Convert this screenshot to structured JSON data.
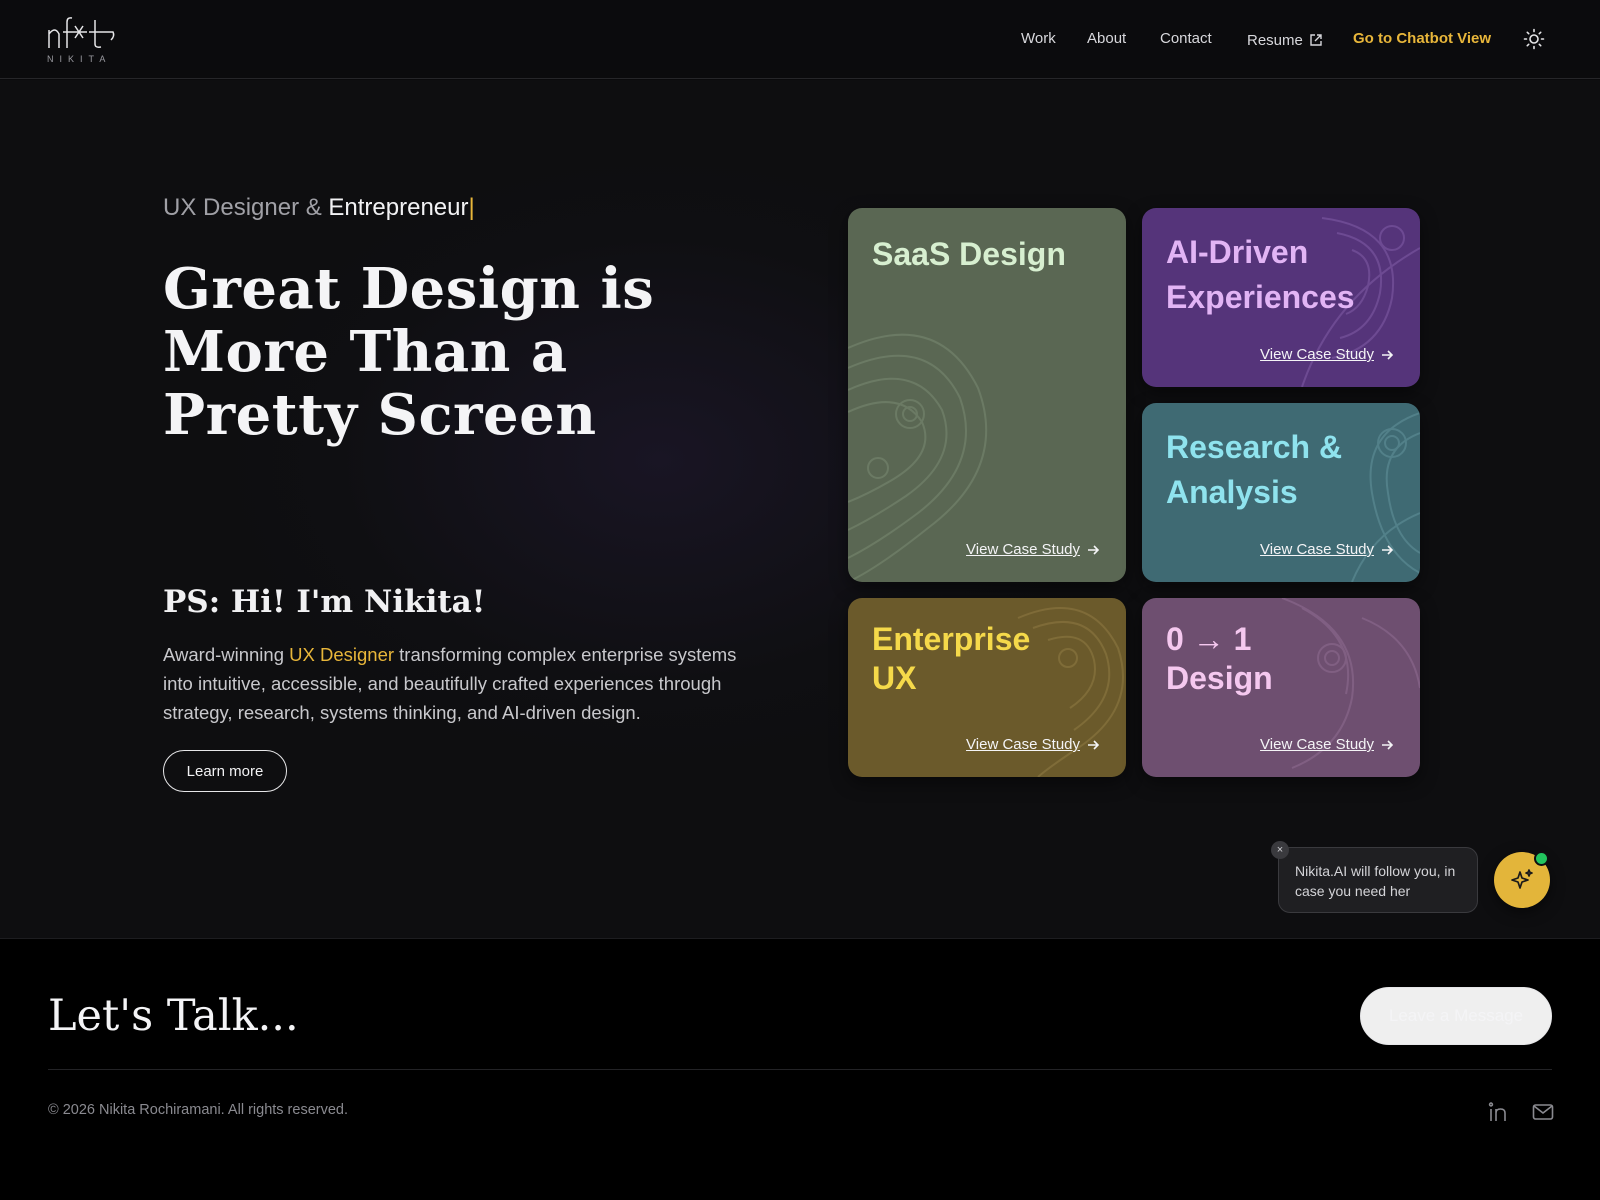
{
  "header": {
    "logo_sub": "NIKITA",
    "nav": {
      "work": "Work",
      "about": "About",
      "contact": "Contact",
      "resume": "Resume",
      "chatbot": "Go to Chatbot View"
    },
    "icons": {
      "resume": "external-link-icon",
      "theme": "sun-icon"
    }
  },
  "hero": {
    "tagline_prefix": "UX Designer & ",
    "tagline_highlight": "Entrepreneur",
    "tagline_cursor": "|",
    "headline": "Great Design is More Than a Pretty Screen",
    "ps": "PS: Hi! I'm Nikita!",
    "bio_prefix": "Award-winning ",
    "bio_accent": "UX Designer",
    "bio_suffix": " transforming complex enterprise systems into intuitive, accessible, and beautifully crafted experiences through strategy, research, systems thinking, and AI-driven design.",
    "learn_more": "Learn more"
  },
  "cards": {
    "link_label": "View Case Study",
    "saas": {
      "title": "SaaS Design"
    },
    "ai": {
      "title_line1": "AI-Driven",
      "title_line2": "Experiences"
    },
    "research": {
      "title_line1": "Research &",
      "title_line2": "Analysis"
    },
    "enterprise": {
      "title_line1": "Enterprise",
      "title_line2": "UX"
    },
    "zero": {
      "title_line1": "0 → 1",
      "title_line2": "Design"
    }
  },
  "chat": {
    "message": "Nikita.AI will follow you, in case you need her",
    "close": "×",
    "fab_icon": "sparkle-icon"
  },
  "footer": {
    "lets_talk": "Let's Talk...",
    "leave_message": "Leave a Message",
    "copyright": "© 2026 Nikita Rochiramani. All rights reserved.",
    "icons": {
      "linkedin": "linkedin-icon",
      "mail": "mail-icon"
    }
  },
  "colors": {
    "accent": "#e8b63a",
    "saas_bg": "#5a6753",
    "ai_bg": "#55347a",
    "research_bg": "#3f6a73",
    "enterprise_bg": "#6b5a2b",
    "zero_bg": "#6e4f70"
  }
}
